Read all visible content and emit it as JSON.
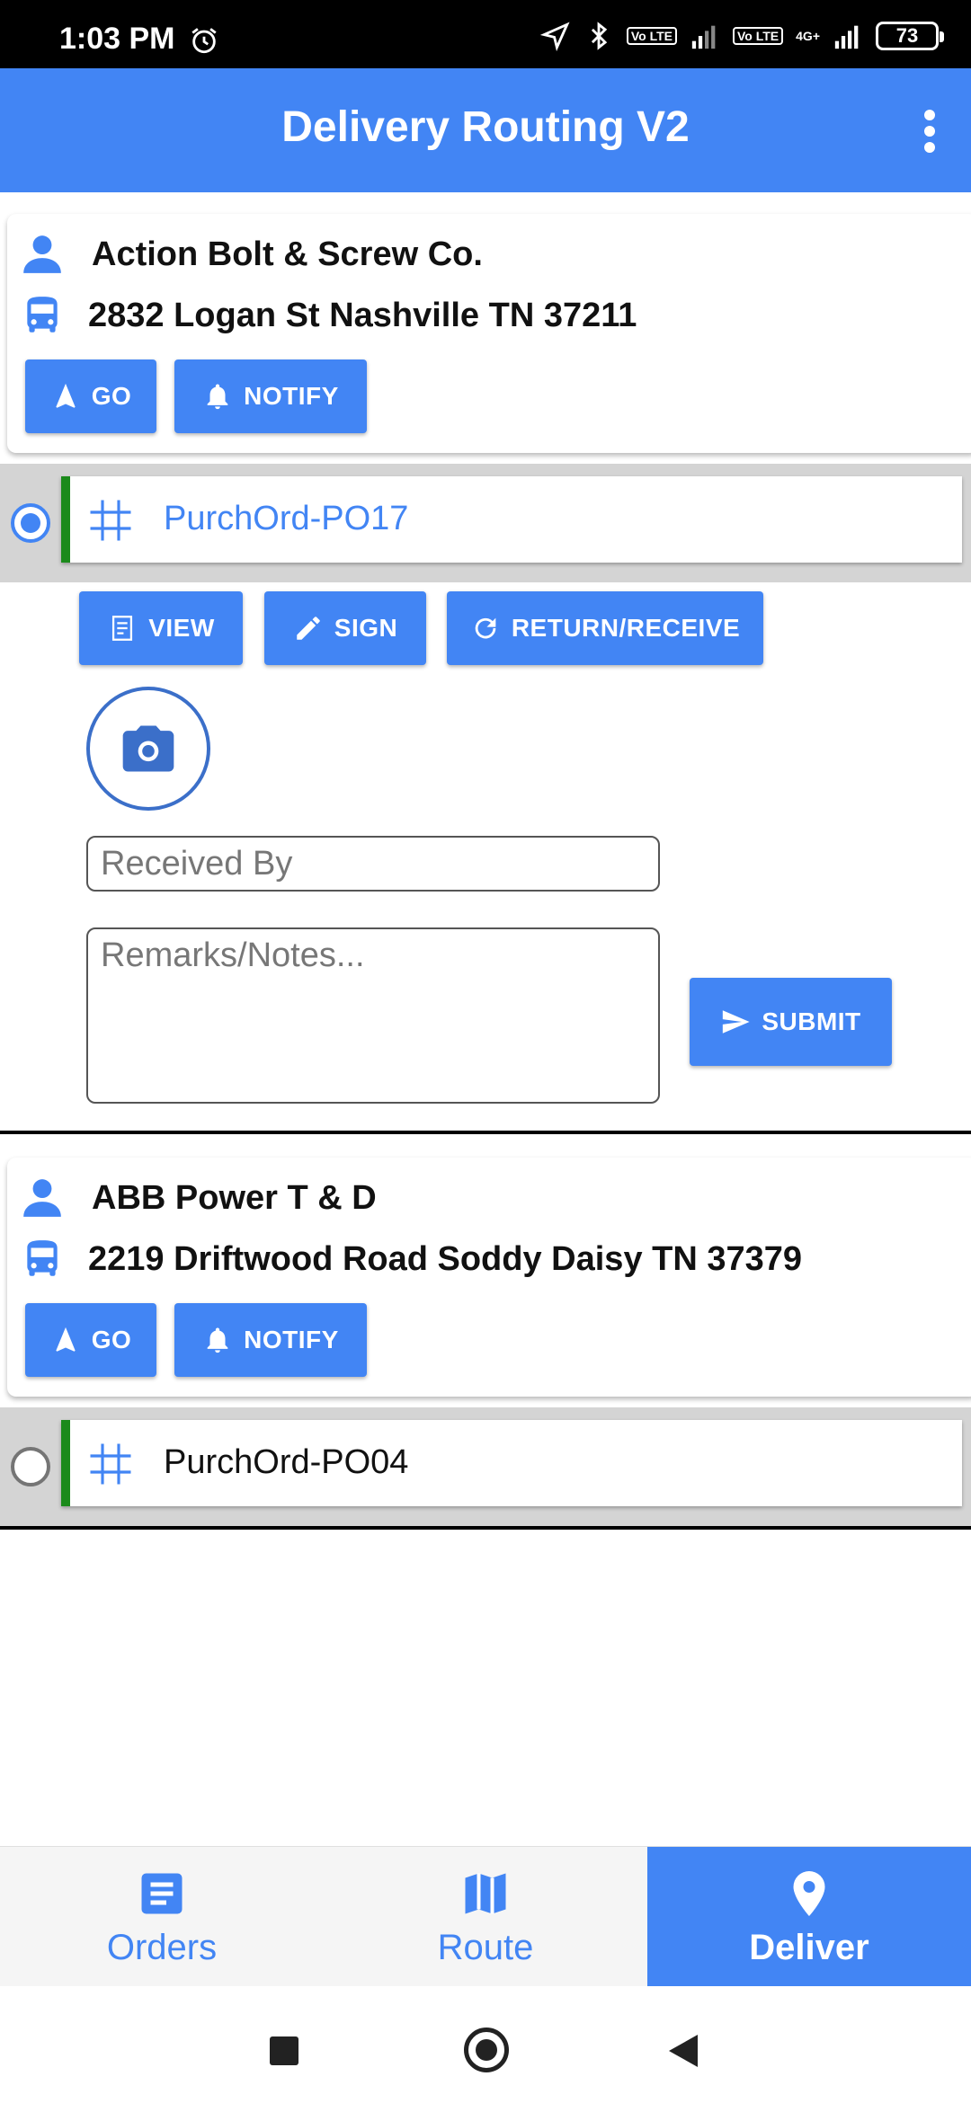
{
  "status_bar": {
    "time": "1:03 PM",
    "volte_1": "Vo LTE",
    "volte_2": "Vo LTE",
    "network": "4G+",
    "battery": "73"
  },
  "app_bar": {
    "title": "Delivery Routing V2"
  },
  "stops": [
    {
      "customer": "Action Bolt & Screw Co.",
      "address": "2832 Logan St Nashville TN 37211",
      "go_label": "GO",
      "notify_label": "NOTIFY",
      "order": {
        "label": "PurchOrd-PO17",
        "selected": true,
        "view_label": "VIEW",
        "sign_label": "SIGN",
        "return_label": "RETURN/RECEIVE",
        "received_by_placeholder": "Received By",
        "remarks_placeholder": "Remarks/Notes...",
        "submit_label": "SUBMIT"
      }
    },
    {
      "customer": "ABB Power T & D",
      "address": "2219 Driftwood Road Soddy Daisy TN 37379",
      "go_label": "GO",
      "notify_label": "NOTIFY",
      "order": {
        "label": "PurchOrd-PO04",
        "selected": false
      }
    }
  ],
  "bottom_nav": {
    "items": [
      {
        "label": "Orders",
        "icon": "document-icon",
        "active": false
      },
      {
        "label": "Route",
        "icon": "map-icon",
        "active": false
      },
      {
        "label": "Deliver",
        "icon": "location-pin-icon",
        "active": true
      }
    ]
  },
  "colors": {
    "primary": "#4285f4",
    "order_accent": "#1b8a1b",
    "strip": "#d4d4d4"
  }
}
